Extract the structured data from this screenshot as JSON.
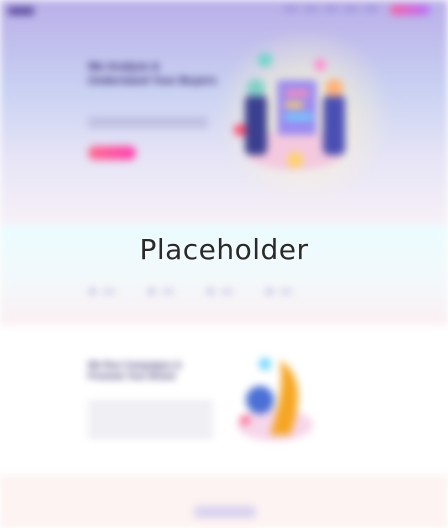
{
  "header": {
    "nav_items": [
      "",
      "",
      "",
      "",
      ""
    ]
  },
  "hero": {
    "title": "We Analyze & Understand Your Buyers"
  },
  "stats": [
    {
      "value": "",
      "icon": "stat-dot-icon"
    },
    {
      "value": "",
      "icon": "stat-dot-icon"
    },
    {
      "value": "",
      "icon": "stat-dot-icon"
    },
    {
      "value": "",
      "icon": "stat-dot-icon"
    }
  ],
  "feature": {
    "title": "We Run Campaigns & Promote Your Brand"
  },
  "overlay": {
    "placeholder_text": "Placeholder"
  },
  "colors": {
    "accent": "#ff3fb0",
    "brand": "#2c1f66",
    "hero_bg": "#c9d1f2",
    "band_bg": "#eafcff",
    "footer_bg": "#fdf3f2"
  }
}
